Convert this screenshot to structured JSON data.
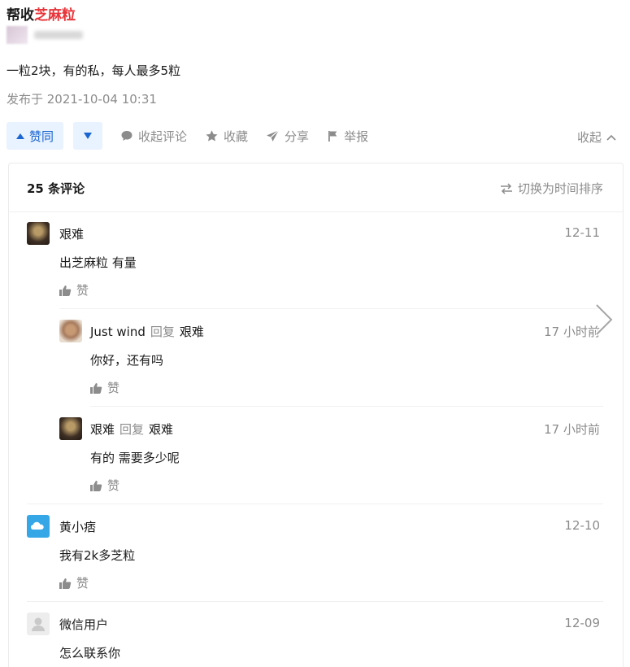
{
  "post": {
    "title_prefix": "帮收",
    "title_highlight": "芝麻粒",
    "body": "一粒2块，有的私，每人最多5粒",
    "time": "发布于 2021-10-04 10:31"
  },
  "actions": {
    "upvote": "赞同",
    "collapse_comments": "收起评论",
    "favorite": "收藏",
    "share": "分享",
    "report": "举报",
    "collapse": "收起",
    "icons": [
      "triangle-up-icon",
      "triangle-down-icon",
      "comment-bubble-icon",
      "star-icon",
      "paper-plane-icon",
      "flag-icon",
      "chevron-up-icon"
    ]
  },
  "comments_panel": {
    "count_label": "25 条评论",
    "sort_label": "切换为时间排序",
    "comments": [
      {
        "author": "艰难",
        "time": "12-11",
        "text": "出芝麻粒 有量",
        "like": "赞"
      },
      {
        "author": "Just wind",
        "reply_word": "回复",
        "reply_to": "艰难",
        "time": "17 小时前",
        "text": "你好，还有吗",
        "like": "赞"
      },
      {
        "author": "艰难",
        "reply_word": "回复",
        "reply_to": "艰难",
        "time": "17 小时前",
        "text": "有的 需要多少呢",
        "like": "赞"
      },
      {
        "author": "黄小痞",
        "time": "12-10",
        "text": "我有2k多芝粒",
        "like": "赞"
      },
      {
        "author": "微信用户",
        "time": "12-09",
        "text": "怎么联系你"
      }
    ]
  },
  "colors": {
    "accent_blue": "#1966d2",
    "upvote_bg": "#e9f2ff",
    "title_highlight": "#e8343a",
    "muted_text": "#8c8c8c"
  }
}
